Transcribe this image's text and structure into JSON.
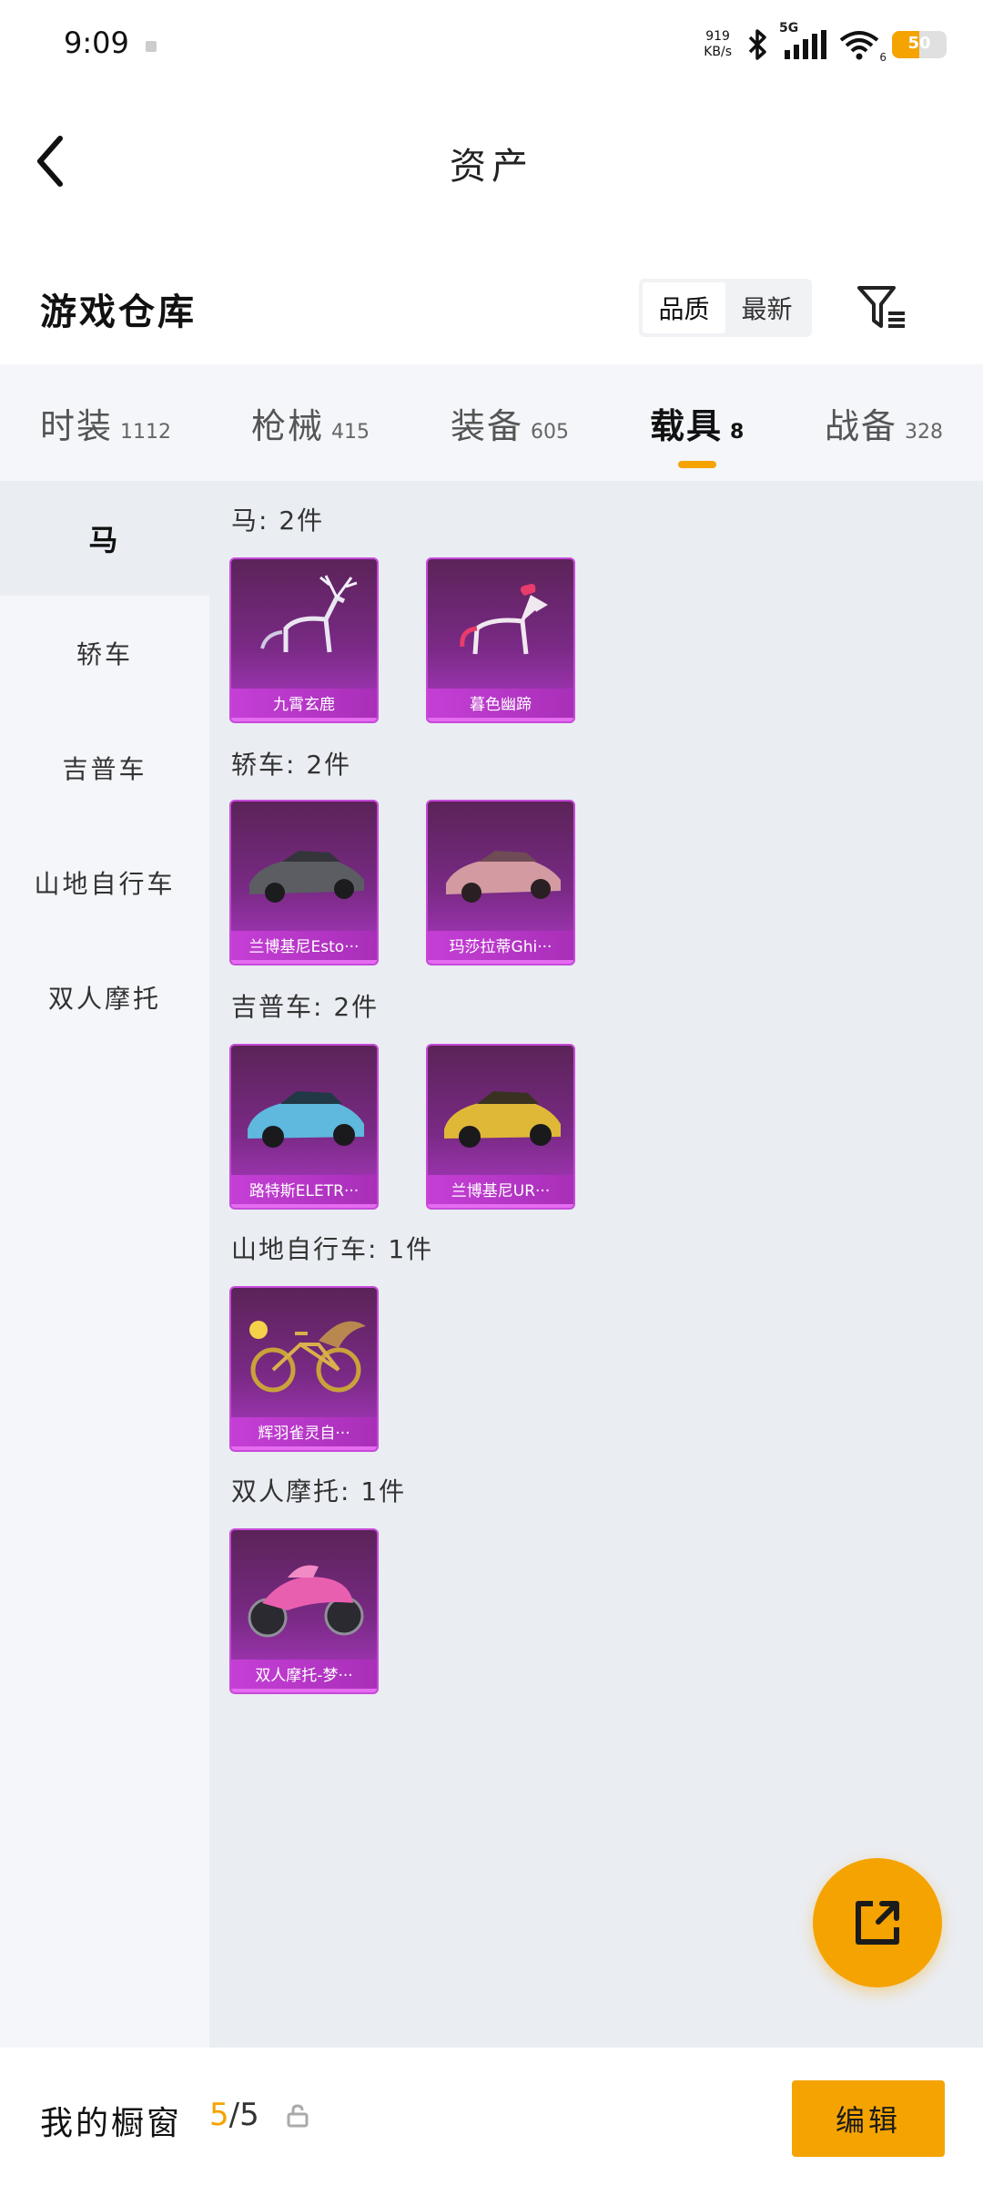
{
  "status_bar": {
    "time": "9:09",
    "net_speed_value": "919",
    "net_speed_unit": "KB/s",
    "network_type": "5G",
    "wifi_number": "6",
    "battery": "50"
  },
  "header": {
    "title": "资产"
  },
  "section": {
    "title": "游戏仓库",
    "sort_options": [
      "品质",
      "最新"
    ],
    "sort_selected": "品质"
  },
  "tabs": [
    {
      "label": "时装",
      "count": "1112"
    },
    {
      "label": "枪械",
      "count": "415"
    },
    {
      "label": "装备",
      "count": "605"
    },
    {
      "label": "载具",
      "count": "8",
      "active": true
    },
    {
      "label": "战备",
      "count": "328"
    }
  ],
  "sidebar": {
    "items": [
      "马",
      "轿车",
      "吉普车",
      "山地自行车",
      "双人摩托"
    ],
    "selected": "马"
  },
  "groups": [
    {
      "title": "马: 2件",
      "items": [
        {
          "name": "九霄玄鹿",
          "icon": "deer-icon"
        },
        {
          "name": "暮色幽蹄",
          "icon": "horse-icon"
        }
      ]
    },
    {
      "title": "轿车: 2件",
      "items": [
        {
          "name": "兰博基尼Esto···",
          "icon": "car-icon"
        },
        {
          "name": "玛莎拉蒂Ghi···",
          "icon": "car-icon"
        }
      ]
    },
    {
      "title": "吉普车: 2件",
      "items": [
        {
          "name": "路特斯ELETR···",
          "icon": "suv-icon"
        },
        {
          "name": "兰博基尼UR···",
          "icon": "suv-icon"
        }
      ]
    },
    {
      "title": "山地自行车: 1件",
      "items": [
        {
          "name": "辉羽雀灵自···",
          "icon": "bike-icon"
        }
      ]
    },
    {
      "title": "双人摩托: 1件",
      "items": [
        {
          "name": "双人摩托-梦···",
          "icon": "motorcycle-icon"
        }
      ]
    }
  ],
  "bottom_bar": {
    "label": "我的橱窗",
    "current": "5",
    "total": "/5",
    "edit_label": "编辑"
  },
  "colors": {
    "accent": "#f5a300",
    "card_purple": "#7a2a86",
    "card_caption": "#c53fd6"
  }
}
